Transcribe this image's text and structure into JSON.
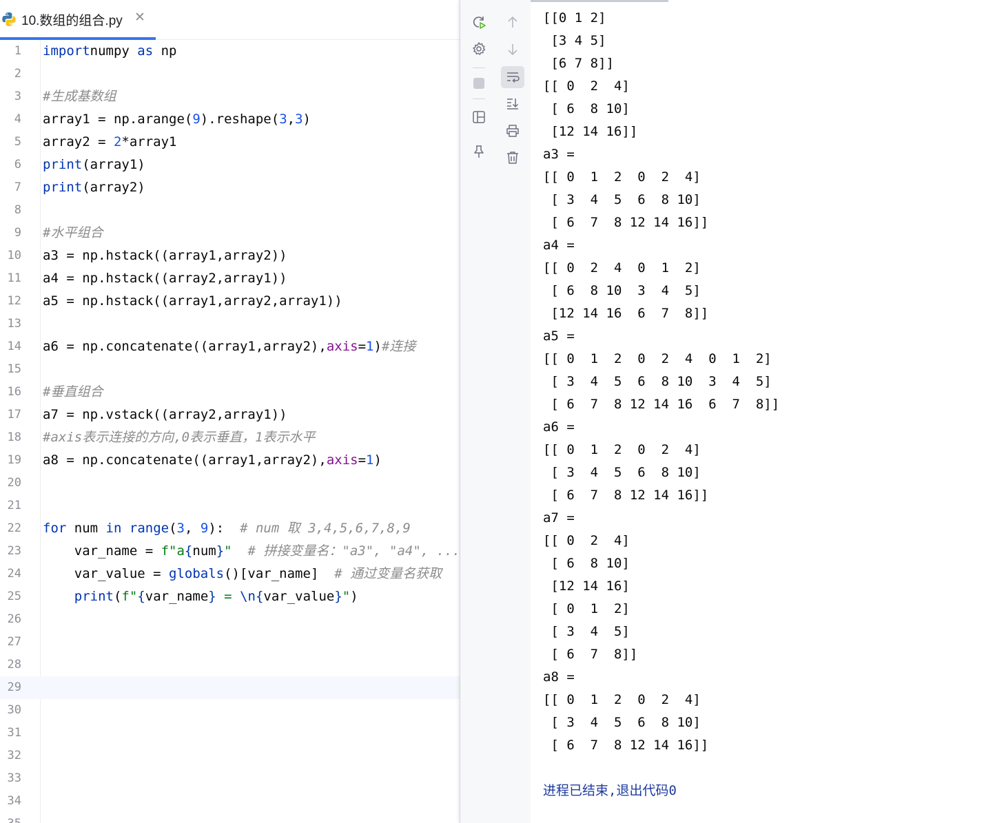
{
  "tab": {
    "title": "10.数组的组合.py"
  },
  "editor": {
    "lines": [
      {
        "n": "1",
        "segs": [
          [
            "kw",
            "import"
          ],
          [
            "",
            "numpy "
          ],
          [
            "kw",
            "as"
          ],
          [
            "",
            " np"
          ]
        ]
      },
      {
        "n": "2",
        "segs": []
      },
      {
        "n": "3",
        "segs": [
          [
            "cm",
            "#生成基数组"
          ]
        ]
      },
      {
        "n": "4",
        "segs": [
          [
            "",
            "array1 = np.arange("
          ],
          [
            "num",
            "9"
          ],
          [
            "",
            ").reshape("
          ],
          [
            "num",
            "3"
          ],
          [
            "",
            ","
          ],
          [
            "num",
            "3"
          ],
          [
            "",
            ")"
          ]
        ]
      },
      {
        "n": "5",
        "segs": [
          [
            "",
            "array2 = "
          ],
          [
            "num",
            "2"
          ],
          [
            "",
            "*array1"
          ]
        ]
      },
      {
        "n": "6",
        "segs": [
          [
            "kw",
            "print"
          ],
          [
            "",
            "(array1)"
          ]
        ]
      },
      {
        "n": "7",
        "segs": [
          [
            "kw",
            "print"
          ],
          [
            "",
            "(array2)"
          ]
        ]
      },
      {
        "n": "8",
        "segs": []
      },
      {
        "n": "9",
        "segs": [
          [
            "cm",
            "#水平组合"
          ]
        ]
      },
      {
        "n": "10",
        "segs": [
          [
            "",
            "a3 = np.hstack((array1,array2))"
          ]
        ]
      },
      {
        "n": "11",
        "segs": [
          [
            "",
            "a4 = np.hstack((array2,array1))"
          ]
        ]
      },
      {
        "n": "12",
        "segs": [
          [
            "",
            "a5 = np.hstack((array1,array2,array1))"
          ]
        ]
      },
      {
        "n": "13",
        "segs": []
      },
      {
        "n": "14",
        "segs": [
          [
            "",
            "a6 = np.concatenate((array1,array2),"
          ],
          [
            "kwa",
            "axis"
          ],
          [
            "",
            "="
          ],
          [
            "num",
            "1"
          ],
          [
            "",
            ")"
          ],
          [
            "cm",
            "#连接"
          ]
        ]
      },
      {
        "n": "15",
        "segs": []
      },
      {
        "n": "16",
        "segs": [
          [
            "cm",
            "#垂直组合"
          ]
        ]
      },
      {
        "n": "17",
        "segs": [
          [
            "",
            "a7 = np.vstack((array2,array1))"
          ]
        ]
      },
      {
        "n": "18",
        "segs": [
          [
            "cm",
            "#axis表示连接的方向,0表示垂直，1表示水平"
          ]
        ]
      },
      {
        "n": "19",
        "segs": [
          [
            "",
            "a8 = np.concatenate((array1,array2),"
          ],
          [
            "kwa",
            "axis"
          ],
          [
            "",
            "="
          ],
          [
            "num",
            "1"
          ],
          [
            "",
            ")"
          ]
        ]
      },
      {
        "n": "20",
        "segs": []
      },
      {
        "n": "21",
        "segs": []
      },
      {
        "n": "22",
        "segs": [
          [
            "kw",
            "for"
          ],
          [
            "",
            " num "
          ],
          [
            "kw",
            "in"
          ],
          [
            "",
            " "
          ],
          [
            "kw",
            "range"
          ],
          [
            "",
            "("
          ],
          [
            "num",
            "3"
          ],
          [
            "",
            ", "
          ],
          [
            "num",
            "9"
          ],
          [
            "",
            "):  "
          ],
          [
            "cm",
            "# num 取 3,4,5,6,7,8,9"
          ]
        ]
      },
      {
        "n": "23",
        "segs": [
          [
            "",
            "    var_name = "
          ],
          [
            "str",
            "f\"a"
          ],
          [
            "esc",
            "{"
          ],
          [
            "",
            "num"
          ],
          [
            "esc",
            "}"
          ],
          [
            "str",
            "\""
          ],
          [
            "",
            "  "
          ],
          [
            "cm",
            "# 拼接变量名：\"a3\", \"a4\", ..."
          ]
        ]
      },
      {
        "n": "24",
        "segs": [
          [
            "",
            "    var_value = "
          ],
          [
            "kw",
            "globals"
          ],
          [
            "",
            "()[var_name]  "
          ],
          [
            "cm",
            "# 通过变量名获取"
          ]
        ]
      },
      {
        "n": "25",
        "segs": [
          [
            "",
            "    "
          ],
          [
            "kw",
            "print"
          ],
          [
            "",
            "("
          ],
          [
            "str",
            "f\""
          ],
          [
            "esc",
            "{"
          ],
          [
            "",
            "var_name"
          ],
          [
            "esc",
            "}"
          ],
          [
            "str",
            " = "
          ],
          [
            "esc",
            "\\n{"
          ],
          [
            "",
            "var_value"
          ],
          [
            "esc",
            "}"
          ],
          [
            "str",
            "\""
          ],
          [
            "",
            ")"
          ]
        ]
      },
      {
        "n": "26",
        "segs": []
      },
      {
        "n": "27",
        "segs": []
      },
      {
        "n": "28",
        "segs": []
      },
      {
        "n": "29",
        "segs": [],
        "current": true
      },
      {
        "n": "30",
        "segs": []
      },
      {
        "n": "31",
        "segs": []
      },
      {
        "n": "32",
        "segs": []
      },
      {
        "n": "33",
        "segs": []
      },
      {
        "n": "34",
        "segs": []
      },
      {
        "n": "35",
        "segs": []
      }
    ]
  },
  "console": {
    "lines": [
      "[[0 1 2]",
      " [3 4 5]",
      " [6 7 8]]",
      "[[ 0  2  4]",
      " [ 6  8 10]",
      " [12 14 16]]",
      "a3 =",
      "[[ 0  1  2  0  2  4]",
      " [ 3  4  5  6  8 10]",
      " [ 6  7  8 12 14 16]]",
      "a4 =",
      "[[ 0  2  4  0  1  2]",
      " [ 6  8 10  3  4  5]",
      " [12 14 16  6  7  8]]",
      "a5 =",
      "[[ 0  1  2  0  2  4  0  1  2]",
      " [ 3  4  5  6  8 10  3  4  5]",
      " [ 6  7  8 12 14 16  6  7  8]]",
      "a6 =",
      "[[ 0  1  2  0  2  4]",
      " [ 3  4  5  6  8 10]",
      " [ 6  7  8 12 14 16]]",
      "a7 =",
      "[[ 0  2  4]",
      " [ 6  8 10]",
      " [12 14 16]",
      " [ 0  1  2]",
      " [ 3  4  5]",
      " [ 6  7  8]]",
      "a8 =",
      "[[ 0  1  2  0  2  4]",
      " [ 3  4  5  6  8 10]",
      " [ 6  7  8 12 14 16]]"
    ],
    "exit_message": "进程已结束,退出代码0"
  }
}
